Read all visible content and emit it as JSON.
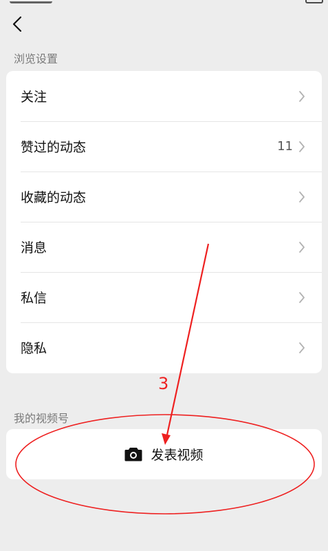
{
  "browse_settings": {
    "label": "浏览设置",
    "items": [
      {
        "label": "关注",
        "count": ""
      },
      {
        "label": "赞过的动态",
        "count": "11"
      },
      {
        "label": "收藏的动态",
        "count": ""
      },
      {
        "label": "消息",
        "count": ""
      },
      {
        "label": "私信",
        "count": ""
      },
      {
        "label": "隐私",
        "count": ""
      }
    ]
  },
  "my_channel": {
    "label": "我的视频号",
    "publish_label": "发表视频"
  },
  "annotation": {
    "step_number": "3",
    "color": "#ee2020"
  },
  "icons": {
    "back": "chevron-left-icon",
    "row_arrow": "chevron-right-icon",
    "publish": "camera-icon"
  },
  "colors": {
    "background": "#ededed",
    "card": "#ffffff",
    "section_label": "#7a7a7a",
    "chevron": "#b2b2b2"
  }
}
